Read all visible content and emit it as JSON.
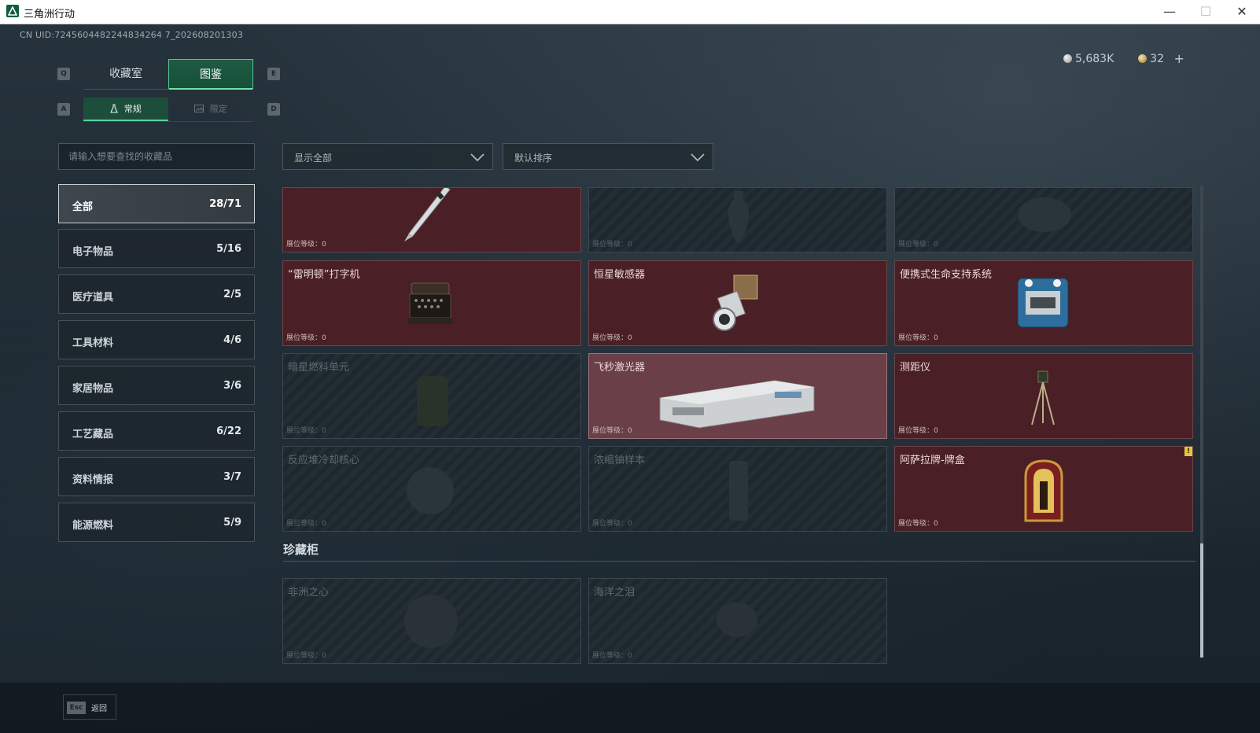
{
  "window": {
    "title": "三角洲行动",
    "minimize": "—",
    "maximize": "☐",
    "close": "✕"
  },
  "uid": "CN UID:7245604482244834264 7_202608201303",
  "currency": {
    "silver": "5,683K",
    "gold": "32",
    "plus": "+"
  },
  "keys": {
    "tab_left": "Q",
    "tab_right": "E",
    "sub_left": "A",
    "sub_right": "D"
  },
  "tabs": [
    {
      "label": "收藏室"
    },
    {
      "label": "图鉴"
    }
  ],
  "subtabs": [
    {
      "label": "常规"
    },
    {
      "label": "限定"
    }
  ],
  "search": {
    "placeholder": "请输入想要查找的收藏品"
  },
  "filters": {
    "show": "显示全部",
    "sort": "默认排序"
  },
  "categories": [
    {
      "name": "全部",
      "count": "28/71"
    },
    {
      "name": "电子物品",
      "count": "5/16"
    },
    {
      "name": "医疗道具",
      "count": "2/5"
    },
    {
      "name": "工具材料",
      "count": "4/6"
    },
    {
      "name": "家居物品",
      "count": "3/6"
    },
    {
      "name": "工艺藏品",
      "count": "6/22"
    },
    {
      "name": "资料情报",
      "count": "3/7"
    },
    {
      "name": "能源燃料",
      "count": "5/9"
    }
  ],
  "level_label": "展位等级：0",
  "items": [
    {
      "name": "",
      "state": "owned"
    },
    {
      "name": "",
      "state": "locked"
    },
    {
      "name": "",
      "state": "locked"
    },
    {
      "name": "“雷明顿”打字机",
      "state": "owned"
    },
    {
      "name": "恒星敏感器",
      "state": "owned"
    },
    {
      "name": "便携式生命支持系统",
      "state": "owned"
    },
    {
      "name": "暗星燃料单元",
      "state": "locked"
    },
    {
      "name": "飞秒激光器",
      "state": "highlight"
    },
    {
      "name": "测距仪",
      "state": "owned"
    },
    {
      "name": "反应堆冷却核心",
      "state": "locked"
    },
    {
      "name": "浓缩铀样本",
      "state": "locked"
    },
    {
      "name": "阿萨拉牌-牌盒",
      "state": "owned",
      "badge": "!"
    }
  ],
  "section": {
    "title": "珍藏柜",
    "items": [
      {
        "name": "非洲之心",
        "state": "locked"
      },
      {
        "name": "海洋之泪",
        "state": "locked"
      }
    ]
  },
  "footer": {
    "esc_key": "Esc",
    "back_label": "返回"
  },
  "colors": {
    "accent": "#58d39c",
    "owned_card": "#4a1f25",
    "locked_card": "#232d34"
  }
}
